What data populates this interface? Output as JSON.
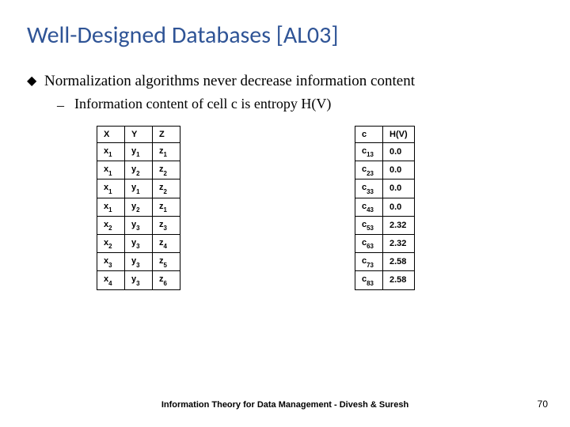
{
  "title": "Well-Designed Databases [AL03]",
  "bullet": "Normalization algorithms never decrease information content",
  "subbullet": "Information content of cell c is entropy H(V)",
  "table_left": {
    "headers": [
      "X",
      "Y",
      "Z"
    ],
    "rows": [
      [
        "x1",
        "y1",
        "z1"
      ],
      [
        "x1",
        "y2",
        "z2"
      ],
      [
        "x1",
        "y1",
        "z2"
      ],
      [
        "x1",
        "y2",
        "z1"
      ],
      [
        "x2",
        "y3",
        "z3"
      ],
      [
        "x2",
        "y3",
        "z4"
      ],
      [
        "x3",
        "y3",
        "z5"
      ],
      [
        "x4",
        "y3",
        "z6"
      ]
    ]
  },
  "table_right": {
    "headers": [
      "c",
      "H(V)"
    ],
    "rows": [
      [
        "c13",
        "0.0"
      ],
      [
        "c23",
        "0.0"
      ],
      [
        "c33",
        "0.0"
      ],
      [
        "c43",
        "0.0"
      ],
      [
        "c53",
        "2.32"
      ],
      [
        "c63",
        "2.32"
      ],
      [
        "c73",
        "2.58"
      ],
      [
        "c83",
        "2.58"
      ]
    ]
  },
  "footer": "Information Theory for Data Management - Divesh & Suresh",
  "pagenum": "70"
}
